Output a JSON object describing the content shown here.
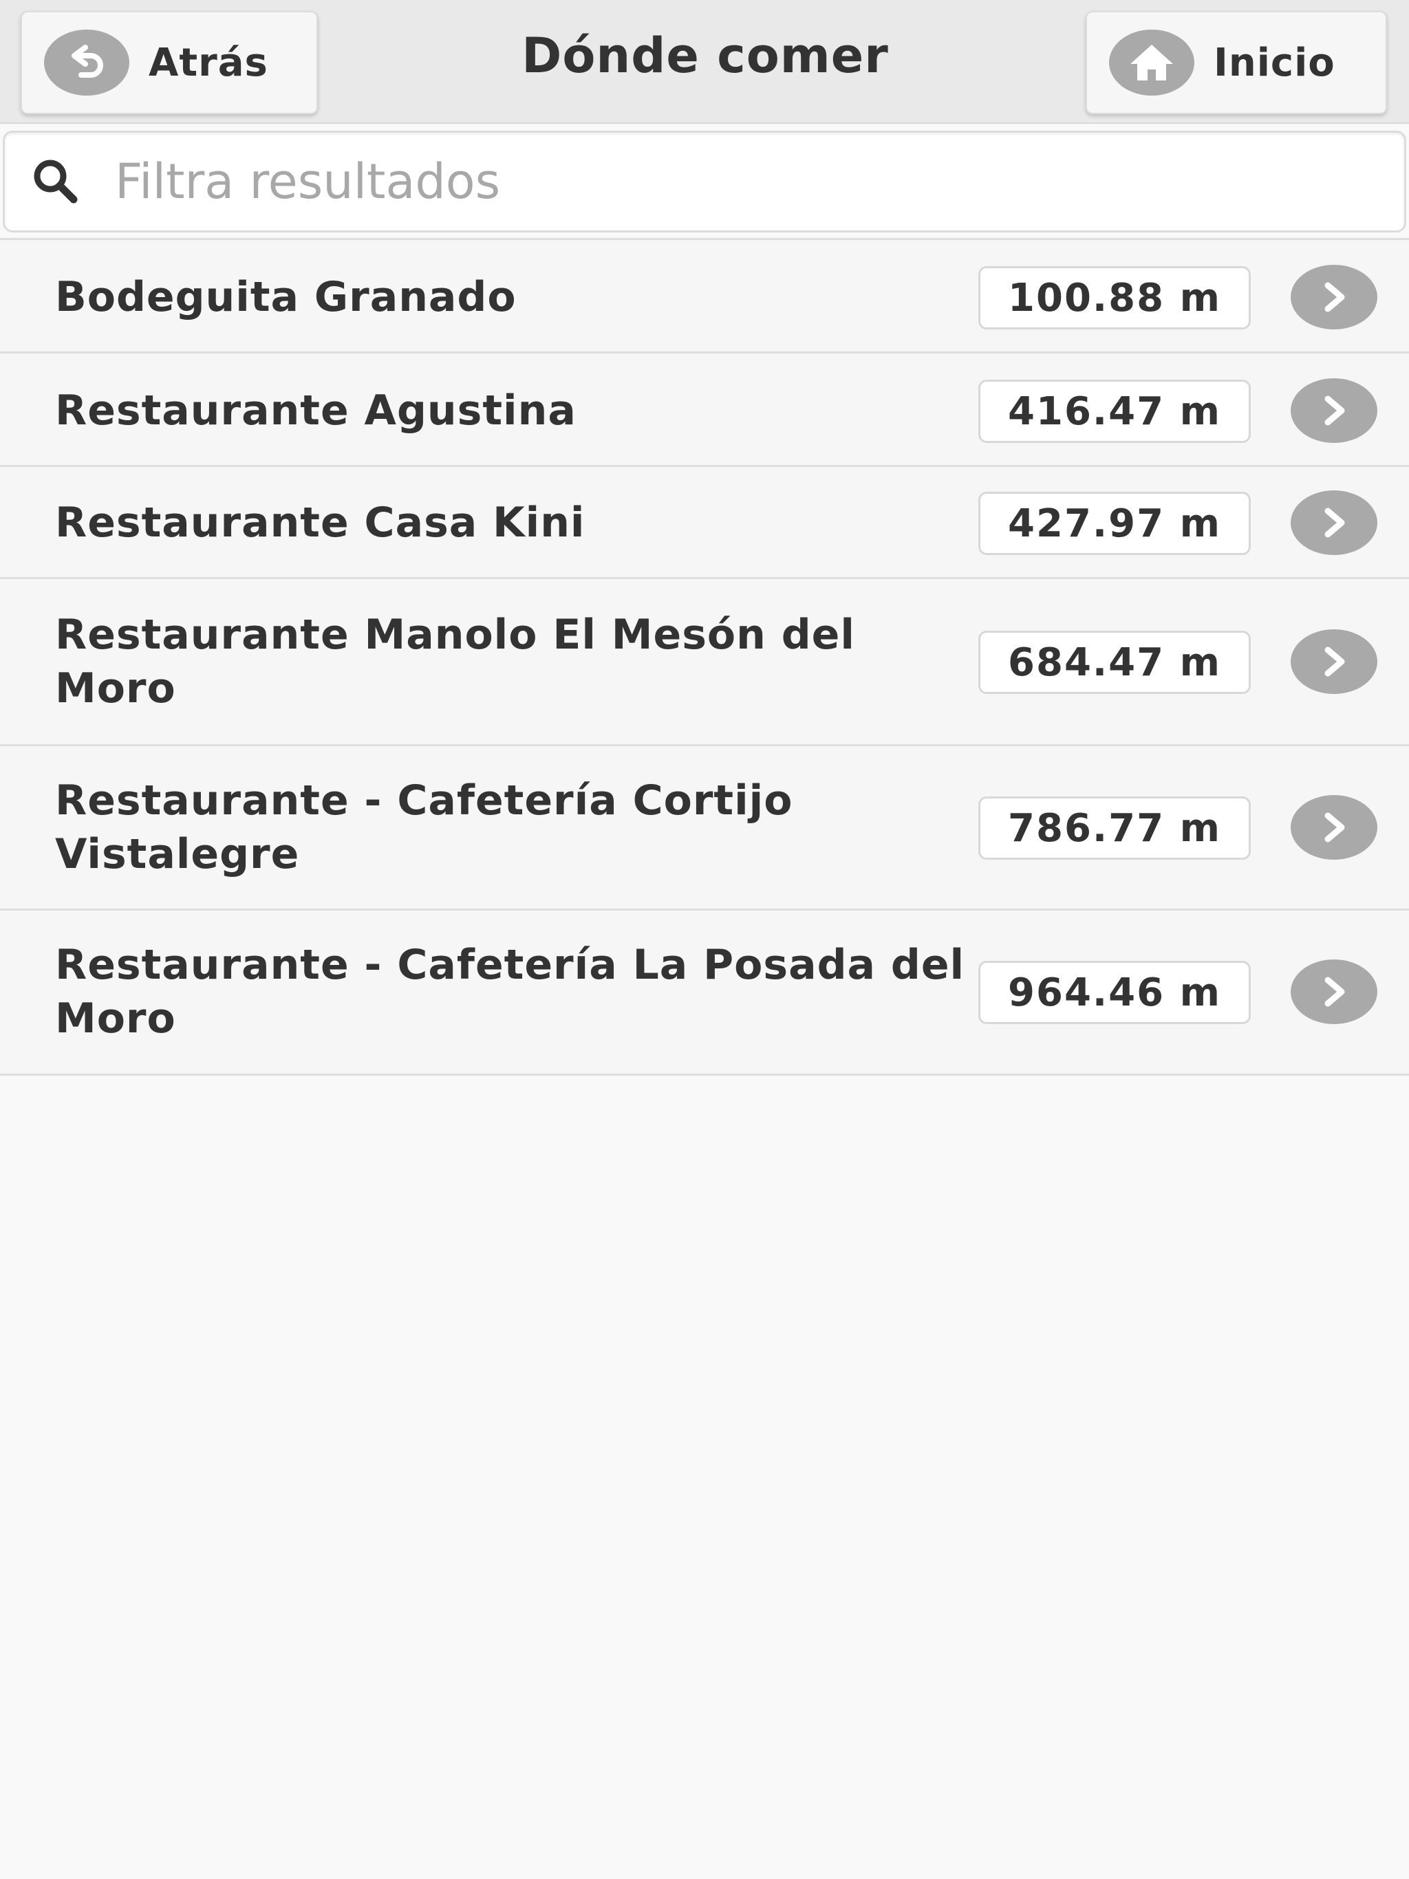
{
  "header": {
    "back_label": "Atrás",
    "title": "Dónde comer",
    "home_label": "Inicio"
  },
  "search": {
    "placeholder": "Filtra resultados",
    "value": ""
  },
  "restaurants": [
    {
      "name": "Bodeguita Granado",
      "distance": "100.88 m"
    },
    {
      "name": "Restaurante Agustina",
      "distance": "416.47 m"
    },
    {
      "name": "Restaurante Casa Kini",
      "distance": "427.97 m"
    },
    {
      "name": "Restaurante Manolo El Mesón del Moro",
      "distance": "684.47 m"
    },
    {
      "name": "Restaurante - Cafetería Cortijo Vistalegre",
      "distance": "786.77 m"
    },
    {
      "name": "Restaurante - Cafetería La Posada del Moro",
      "distance": "964.46 m"
    }
  ],
  "icons": {
    "back": "back-arrow-icon",
    "home": "home-icon",
    "search": "search-icon",
    "row_arrow": "chevron-right-icon"
  },
  "colors": {
    "header_bg": "#e9e9e9",
    "icon_circle": "#a9a9a9",
    "text": "#333333",
    "row_bg": "#f6f6f6"
  }
}
